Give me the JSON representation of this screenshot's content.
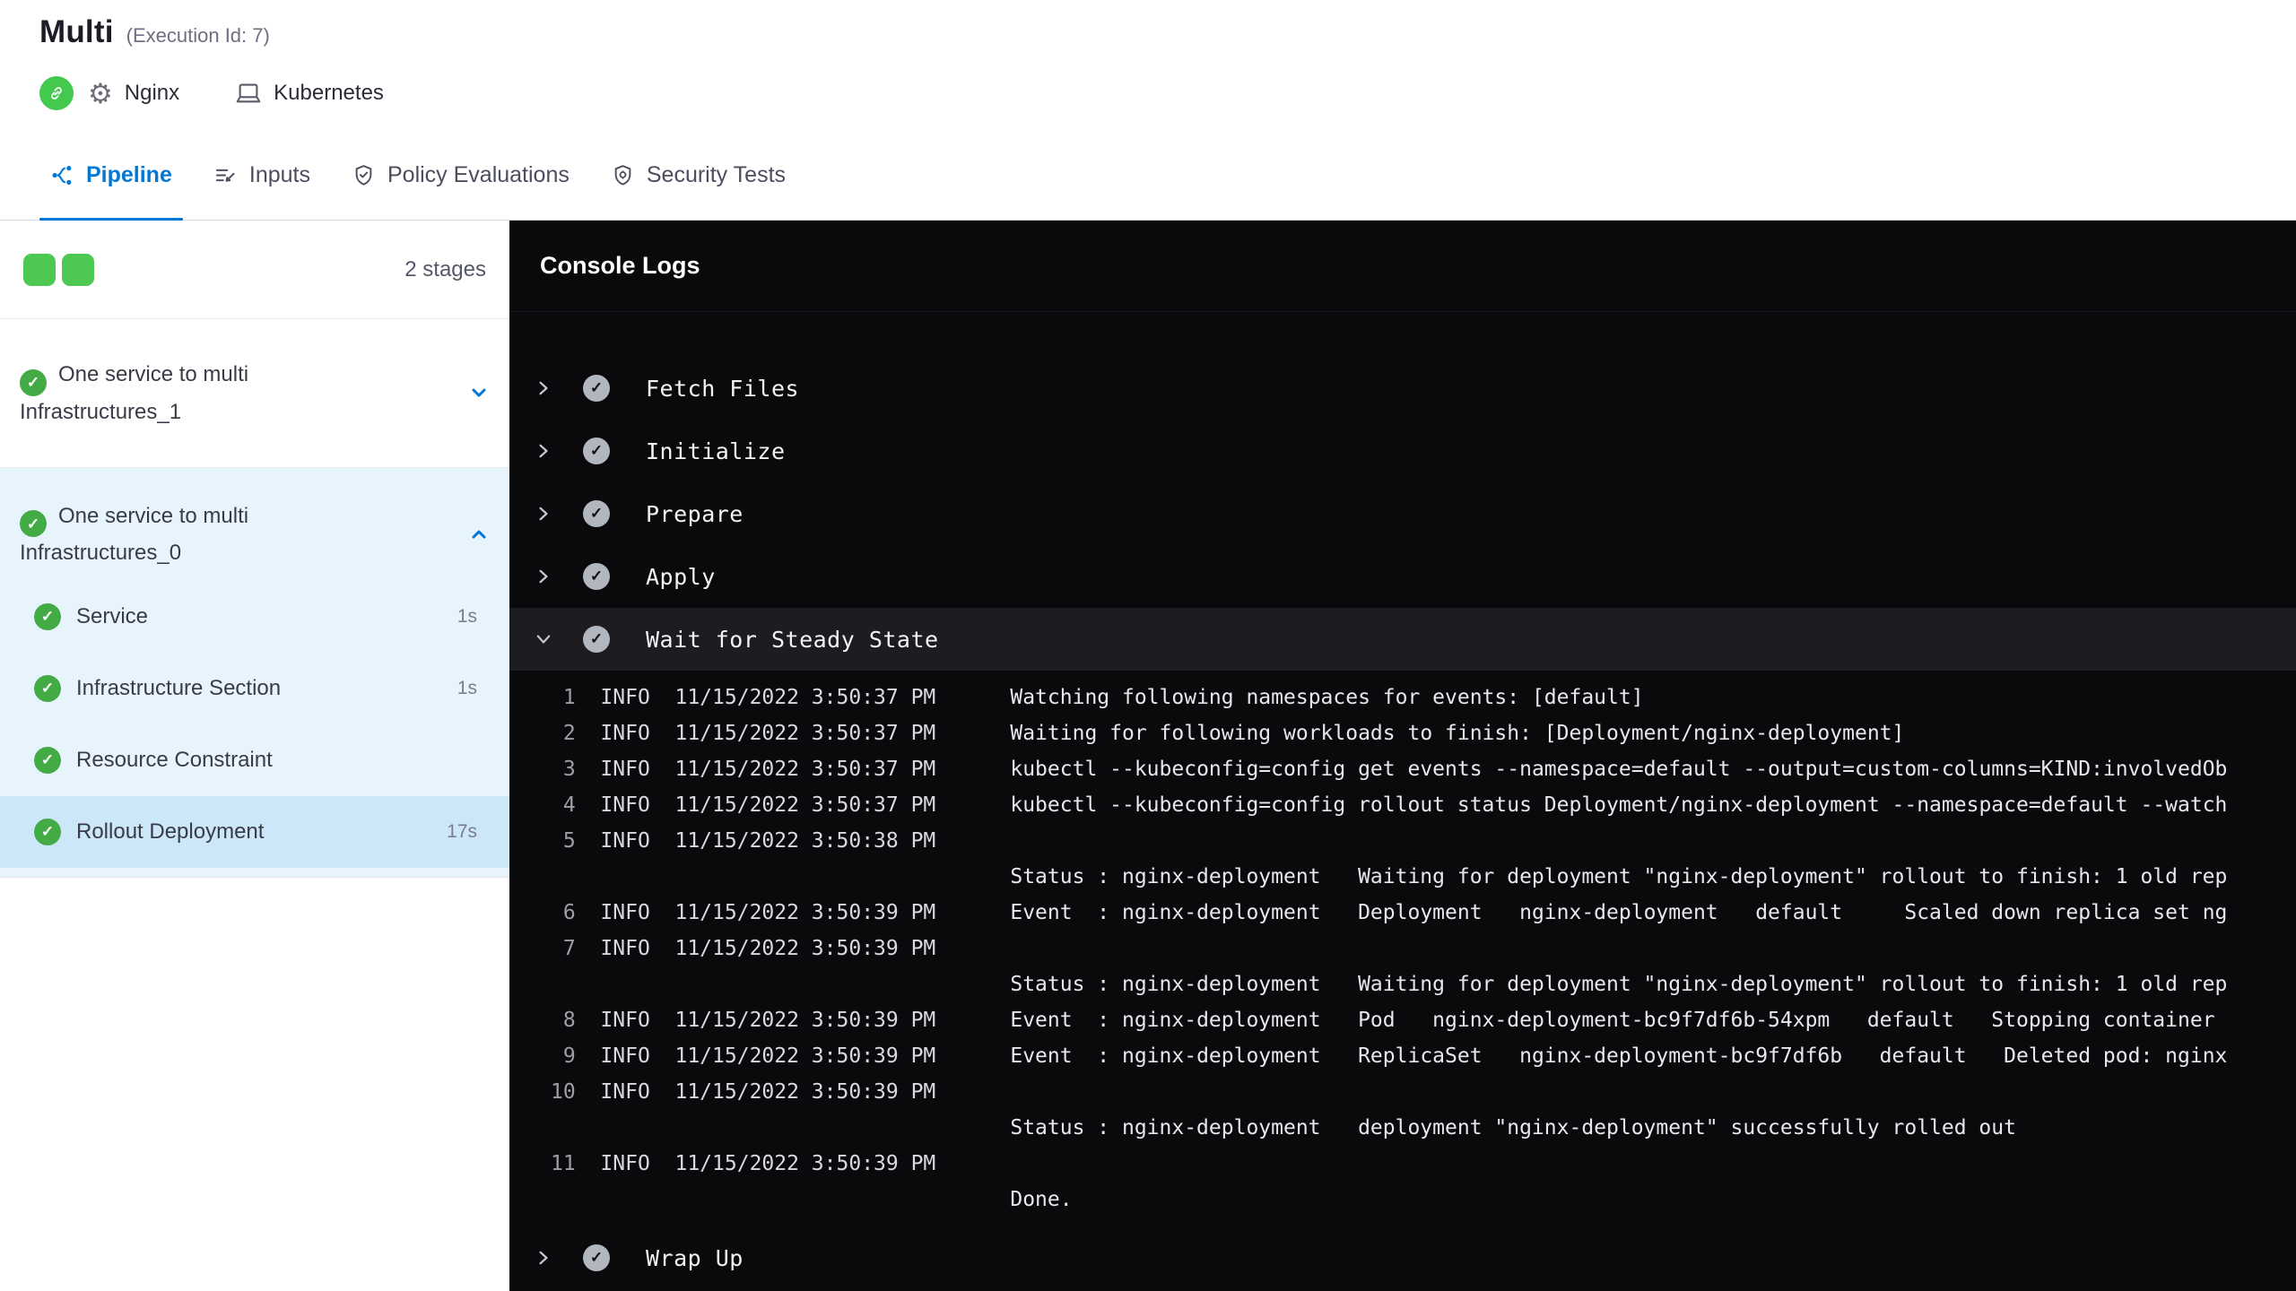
{
  "colors": {
    "accent": "#0278d5",
    "success_green": "#42ab45",
    "stage_square_green": "#4dc952",
    "console_background": "#0a0a0c",
    "expanded_row_background": "#1d1d21",
    "selected_step_background": "#cbe7f8",
    "stage_section_background": "#e7f4fc"
  },
  "header": {
    "title": "Multi",
    "execution_id": "(Execution Id: 7)",
    "service_name": "Nginx",
    "environment_name": "Kubernetes",
    "icons": [
      "service-link-icon",
      "gear-icon",
      "environment-icon"
    ]
  },
  "tabs": [
    {
      "label": "Pipeline",
      "active": true,
      "icon": "pipeline-icon"
    },
    {
      "label": "Inputs",
      "active": false,
      "icon": "inputs-icon"
    },
    {
      "label": "Policy Evaluations",
      "active": false,
      "icon": "policy-shield-check-icon"
    },
    {
      "label": "Security Tests",
      "active": false,
      "icon": "security-shield-icon"
    }
  ],
  "sidebar": {
    "stage_count_label": "2 stages",
    "stage_squares": 2,
    "stages": [
      {
        "name": "One service to multi Infrastructures_1",
        "status": "success",
        "expanded": false
      },
      {
        "name": "One service to multi Infrastructures_0",
        "status": "success",
        "expanded": true,
        "steps": [
          {
            "name": "Service",
            "duration": "1s",
            "status": "success",
            "selected": false
          },
          {
            "name": "Infrastructure Section",
            "duration": "1s",
            "status": "success",
            "selected": false
          },
          {
            "name": "Resource Constraint",
            "duration": "",
            "status": "success",
            "selected": false
          },
          {
            "name": "Rollout Deployment",
            "duration": "17s",
            "status": "success",
            "selected": true
          }
        ]
      }
    ]
  },
  "console": {
    "title": "Console Logs",
    "steps": [
      {
        "label": "Fetch Files",
        "state": "collapsed",
        "status": "success"
      },
      {
        "label": "Initialize",
        "state": "collapsed",
        "status": "success"
      },
      {
        "label": "Prepare",
        "state": "collapsed",
        "status": "success"
      },
      {
        "label": "Apply",
        "state": "collapsed",
        "status": "success"
      },
      {
        "label": "Wait for Steady State",
        "state": "expanded",
        "status": "success"
      },
      {
        "label": "Wrap Up",
        "state": "collapsed",
        "status": "success"
      }
    ],
    "logs": [
      {
        "num": "1",
        "level": "INFO",
        "time": "11/15/2022 3:50:37 PM",
        "lines": [
          "Watching following namespaces for events: [default]"
        ]
      },
      {
        "num": "2",
        "level": "INFO",
        "time": "11/15/2022 3:50:37 PM",
        "lines": [
          "Waiting for following workloads to finish: [Deployment/nginx-deployment]"
        ]
      },
      {
        "num": "3",
        "level": "INFO",
        "time": "11/15/2022 3:50:37 PM",
        "lines": [
          "kubectl --kubeconfig=config get events --namespace=default --output=custom-columns=KIND:involvedOb"
        ]
      },
      {
        "num": "4",
        "level": "INFO",
        "time": "11/15/2022 3:50:37 PM",
        "lines": [
          "kubectl --kubeconfig=config rollout status Deployment/nginx-deployment --namespace=default --watch"
        ]
      },
      {
        "num": "5",
        "level": "INFO",
        "time": "11/15/2022 3:50:38 PM",
        "lines": [
          "",
          "Status : nginx-deployment   Waiting for deployment \"nginx-deployment\" rollout to finish: 1 old rep"
        ]
      },
      {
        "num": "6",
        "level": "INFO",
        "time": "11/15/2022 3:50:39 PM",
        "lines": [
          "Event  : nginx-deployment   Deployment   nginx-deployment   default     Scaled down replica set ng"
        ]
      },
      {
        "num": "7",
        "level": "INFO",
        "time": "11/15/2022 3:50:39 PM",
        "lines": [
          "",
          "Status : nginx-deployment   Waiting for deployment \"nginx-deployment\" rollout to finish: 1 old rep"
        ]
      },
      {
        "num": "8",
        "level": "INFO",
        "time": "11/15/2022 3:50:39 PM",
        "lines": [
          "Event  : nginx-deployment   Pod   nginx-deployment-bc9f7df6b-54xpm   default   Stopping container"
        ]
      },
      {
        "num": "9",
        "level": "INFO",
        "time": "11/15/2022 3:50:39 PM",
        "lines": [
          "Event  : nginx-deployment   ReplicaSet   nginx-deployment-bc9f7df6b   default   Deleted pod: nginx"
        ]
      },
      {
        "num": "10",
        "level": "INFO",
        "time": "11/15/2022 3:50:39 PM",
        "lines": [
          "",
          "Status : nginx-deployment   deployment \"nginx-deployment\" successfully rolled out"
        ]
      },
      {
        "num": "11",
        "level": "INFO",
        "time": "11/15/2022 3:50:39 PM",
        "lines": [
          "",
          "Done."
        ]
      }
    ]
  }
}
